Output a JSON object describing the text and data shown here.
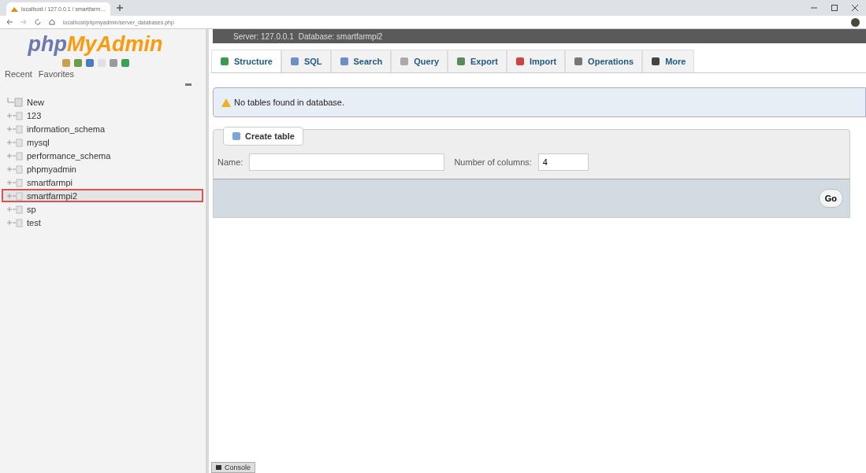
{
  "browser": {
    "tab_title": "localhost / 127.0.0.1 / smartfarm…",
    "address": "localhost/phpmyadmin/server_databases.php"
  },
  "sidebar": {
    "logo_parts": [
      "php",
      "MyAdmin"
    ],
    "links": [
      "Recent",
      "Favorites"
    ],
    "items": [
      {
        "label": "New",
        "kind": "new",
        "selected": false
      },
      {
        "label": "123",
        "kind": "db",
        "selected": false
      },
      {
        "label": "information_schema",
        "kind": "db",
        "selected": false
      },
      {
        "label": "mysql",
        "kind": "db",
        "selected": false
      },
      {
        "label": "performance_schema",
        "kind": "db",
        "selected": false
      },
      {
        "label": "phpmyadmin",
        "kind": "db",
        "selected": false
      },
      {
        "label": "smartfarmpi",
        "kind": "db",
        "selected": false
      },
      {
        "label": "smartfarmpi2",
        "kind": "db",
        "selected": true
      },
      {
        "label": "sp",
        "kind": "db",
        "selected": false
      },
      {
        "label": "test",
        "kind": "db",
        "selected": false
      }
    ]
  },
  "breadcrumb": [
    "Server: 127.0.0.1",
    "Database: smartfarmpi2"
  ],
  "tabs": [
    {
      "label": "Structure",
      "selected": true
    },
    {
      "label": "SQL",
      "selected": false
    },
    {
      "label": "Search",
      "selected": false
    },
    {
      "label": "Query",
      "selected": false
    },
    {
      "label": "Export",
      "selected": false
    },
    {
      "label": "Import",
      "selected": false
    },
    {
      "label": "Operations",
      "selected": false
    },
    {
      "label": "More",
      "selected": false
    }
  ],
  "notice": "No tables found in database.",
  "create_table": {
    "legend": "Create table",
    "name_label": "Name:",
    "columns_label": "Number of columns:",
    "columns_value": "4",
    "button": "Go"
  },
  "console": "Console"
}
